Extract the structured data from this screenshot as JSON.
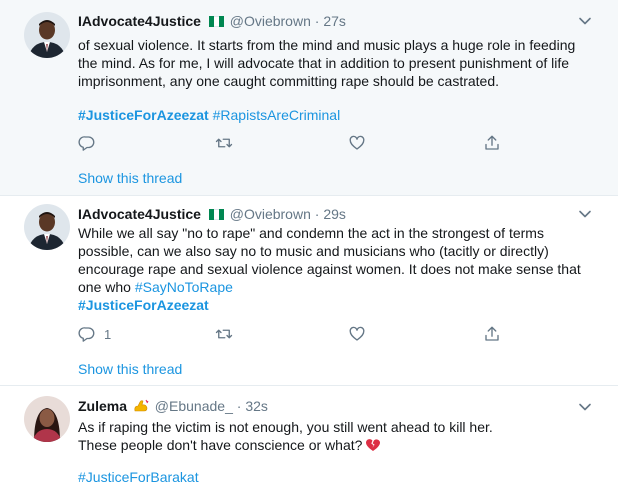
{
  "tweets": [
    {
      "name": "IAdvocate4Justice",
      "handle": "@Oviebrown",
      "dot": "·",
      "time": "27s",
      "lines": [
        "of sexual violence. It starts from the mind and music plays a huge role in feeding",
        "the mind. As for me, I will advocate that in addition to present punishment of life",
        "imprisonment, any one caught committing rape should be castrated."
      ],
      "hashtags": [
        "#JusticeForAzeezat",
        "#RapistsAreCriminal"
      ],
      "show_thread": "Show this thread"
    },
    {
      "name": "IAdvocate4Justice",
      "handle": "@Oviebrown",
      "dot": "·",
      "time": "29s",
      "lines": [
        "While we all say \"no to rape\" and condemn the act in the strongest of terms",
        "possible, can we also say no to music and musicians who (tacitly or directly)",
        "encourage rape and sexual violence against women. It does not make sense that",
        "one who "
      ],
      "inline_hashtag": "#SayNoToRape",
      "hashtag_line": "#JusticeForAzeezat",
      "reply_count": "1",
      "show_thread": "Show this thread"
    },
    {
      "name": "Zulema",
      "handle": "@Ebunade_",
      "dot": "·",
      "time": "32s",
      "lines": [
        "As if raping the victim is not enough, you still went ahead to kill her.",
        "These people don't have conscience or what?"
      ],
      "hashtag": "#JusticeForBarakat"
    }
  ],
  "icons": {
    "reply": "reply-icon",
    "retweet": "retweet-icon",
    "like": "heart-icon",
    "share": "share-icon",
    "menu": "chevron-down-icon",
    "emoji_name": "flexed-biceps-emoji",
    "emoji_text": "broken-heart-emoji"
  },
  "colors": {
    "link": "#1b95e0",
    "muted": "#657786",
    "text": "#14171a",
    "highlight_bg": "#f5f8fa",
    "divider": "#e6ecf0"
  }
}
